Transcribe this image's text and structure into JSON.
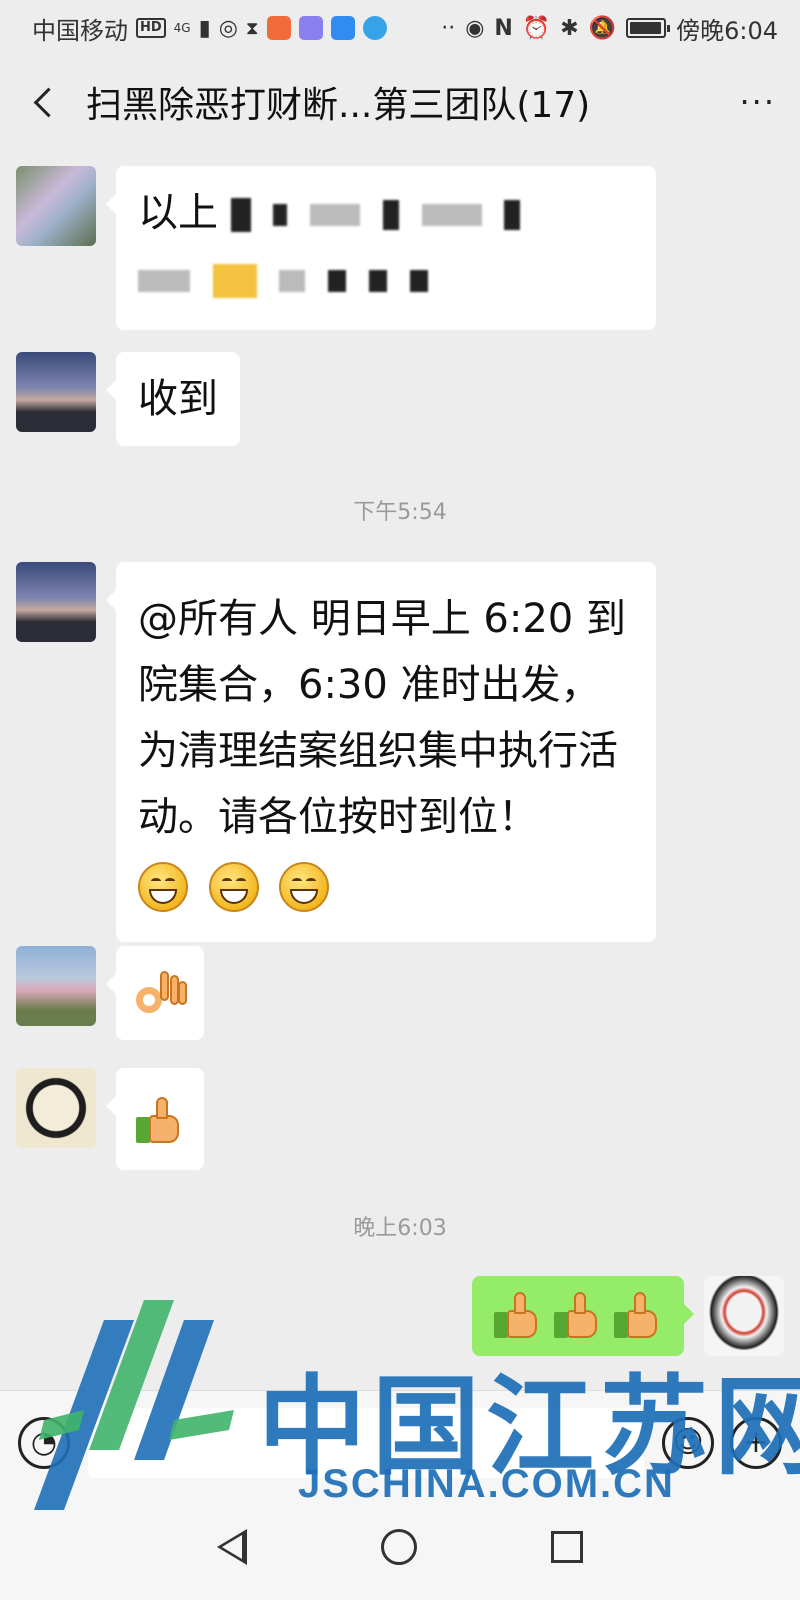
{
  "status_bar": {
    "carrier": "中国移动",
    "hd_badge": "HD",
    "network": "4G",
    "time": "傍晚6:04",
    "battery_level": 0.9,
    "icons": [
      "hd-icon",
      "signal-icon",
      "hotspot-icon",
      "hourglass-icon",
      "video-app-icon",
      "app-icon",
      "location-app-icon",
      "browser-app-icon",
      "more-dots-icon",
      "eye-icon",
      "nfc-icon",
      "alarm-icon",
      "bluetooth-icon",
      "mute-icon",
      "battery-icon"
    ]
  },
  "header": {
    "title": "扫黑除恶打财断...第三团队(17)",
    "more_label": "···"
  },
  "messages": [
    {
      "id": "m1",
      "sender": "received",
      "text": "以上"
    },
    {
      "id": "m2",
      "sender": "received",
      "text": "收到"
    },
    {
      "id": "m3",
      "sender": "received",
      "text": "@所有人 明日早上 6:20 到院集合，6:30 准时出发，为清理结案组织集中执行活动。请各位按时到位！",
      "emoji_count": 3
    },
    {
      "id": "m4",
      "sender": "received",
      "emoji": "ok-hand-icon"
    },
    {
      "id": "m5",
      "sender": "received",
      "emoji": "thumbs-up-icon"
    },
    {
      "id": "m6",
      "sender": "sent",
      "emoji": "thumbs-up-icon",
      "emoji_count": 3
    }
  ],
  "timestamps": [
    "下午5:54",
    "晚上6:03"
  ],
  "watermark": {
    "cn": "中国江苏网",
    "en": "JSCHINA.COM.CN"
  },
  "colors": {
    "background": "#ededed",
    "sent_bubble": "#95ec69",
    "received_bubble": "#ffffff",
    "watermark": "#1e6fb8"
  }
}
